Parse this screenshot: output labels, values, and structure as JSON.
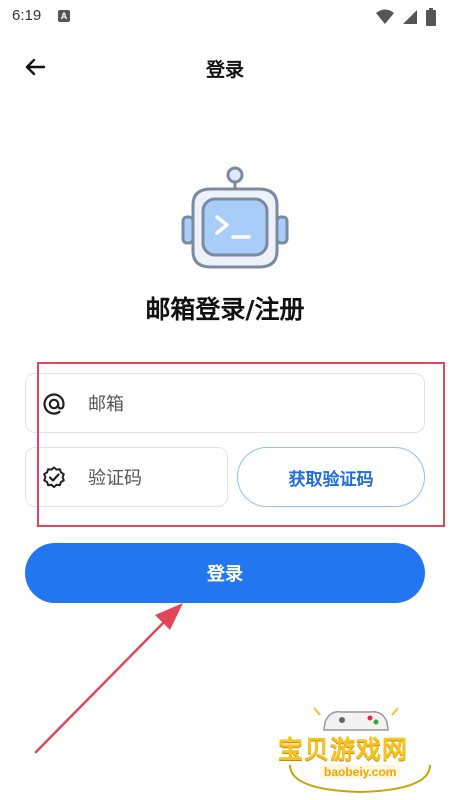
{
  "status_bar": {
    "time": "6:19",
    "notification_letter": "A",
    "icons": [
      "wifi-icon",
      "signal-icon",
      "battery-icon"
    ]
  },
  "app_bar": {
    "title": "登录",
    "back_icon": "arrow-left-icon"
  },
  "logo": {
    "icon": "robot-terminal-icon",
    "accent": "#a9cdf9"
  },
  "headline": "邮箱登录/注册",
  "form": {
    "email": {
      "placeholder": "邮箱",
      "value": "",
      "icon": "at-icon"
    },
    "code": {
      "placeholder": "验证码",
      "value": "",
      "icon": "badge-check-icon"
    },
    "get_code_label": "获取验证码",
    "submit_label": "登录"
  },
  "annotation": {
    "box_color": "#e0485a"
  },
  "watermark": {
    "text": "宝贝游戏网",
    "domain": "baobeiy.com"
  },
  "colors": {
    "primary": "#2277f0",
    "outline": "#8ec0f3"
  }
}
